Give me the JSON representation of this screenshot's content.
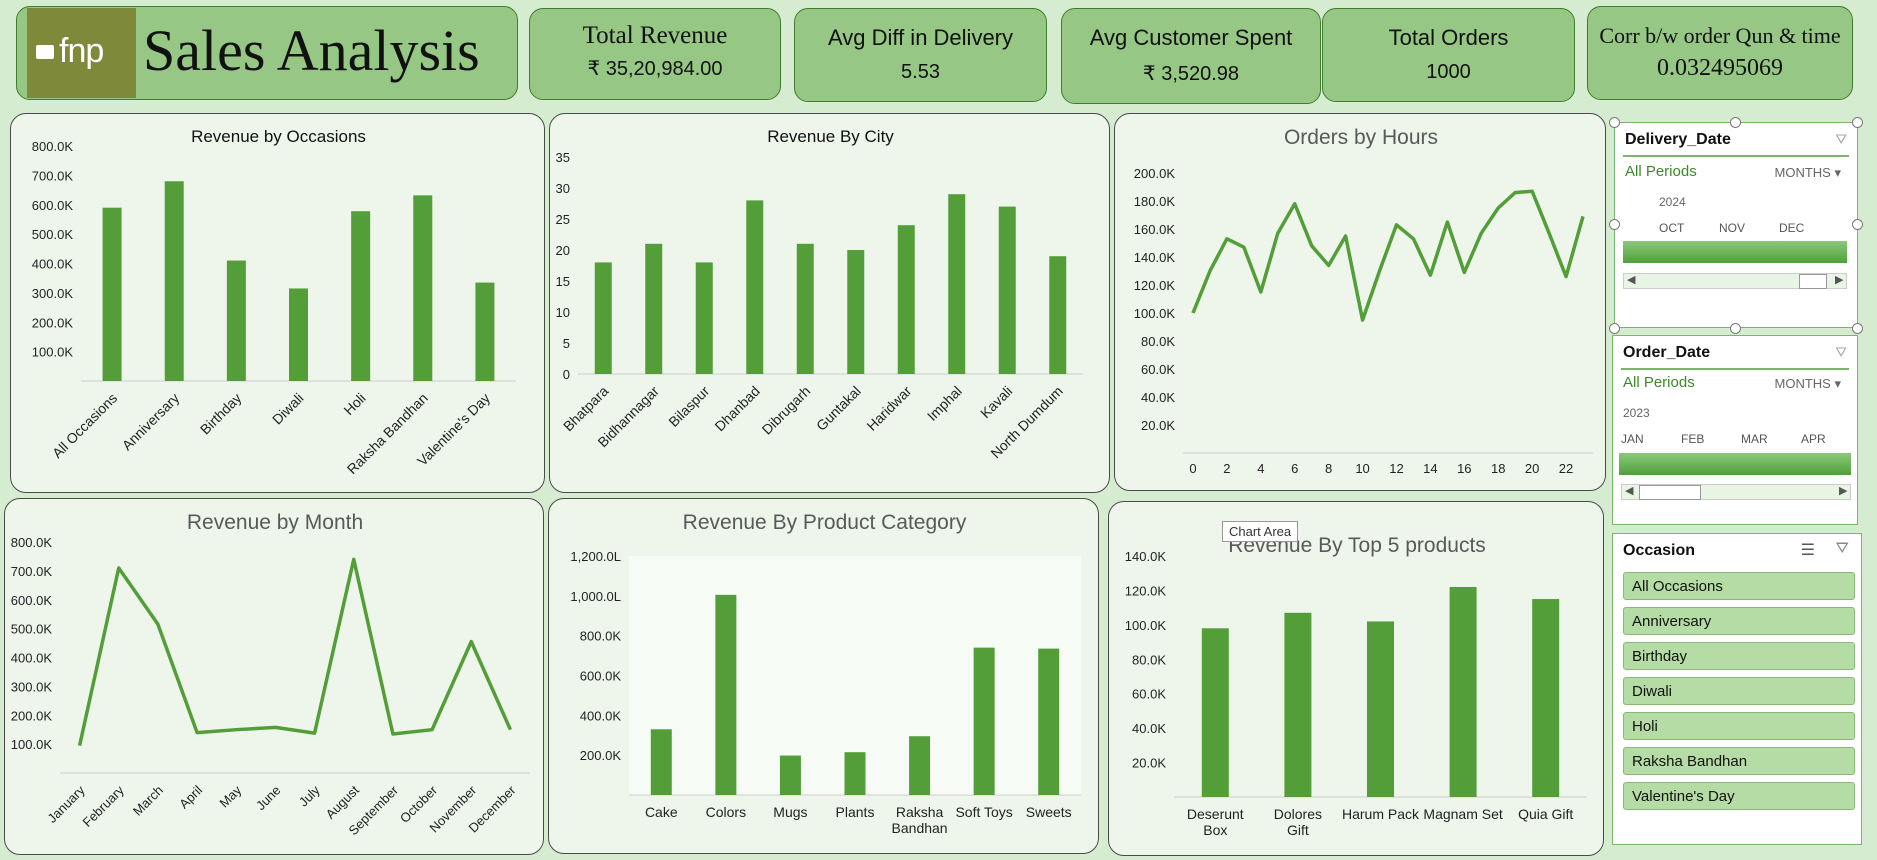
{
  "header": {
    "logo_text": "fnp",
    "title": "Sales Analysis"
  },
  "kpis": {
    "total_revenue": {
      "title": "Total Revenue",
      "value": "₹ 35,20,984.00"
    },
    "avg_diff": {
      "title": "Avg Diff in Delivery",
      "value": "5.53"
    },
    "avg_spent": {
      "title": "Avg Customer Spent",
      "value": "₹ 3,520.98"
    },
    "total_orders": {
      "title": "Total Orders",
      "value": "1000"
    },
    "corr": {
      "title": "Corr b/w order Qun &  time",
      "value": "0.032495069"
    }
  },
  "tooltip": "Chart Area",
  "slicers": {
    "delivery": {
      "title": "Delivery_Date",
      "period": "All Periods",
      "months": "MONTHS",
      "year": "2024",
      "month_labels": [
        "OCT",
        "NOV",
        "DEC"
      ]
    },
    "order": {
      "title": "Order_Date",
      "period": "All Periods",
      "months": "MONTHS",
      "year": "2023",
      "month_labels": [
        "JAN",
        "FEB",
        "MAR",
        "APR"
      ]
    },
    "occasion": {
      "title": "Occasion",
      "items": [
        "All Occasions",
        "Anniversary",
        "Birthday",
        "Diwali",
        "Holi",
        "Raksha Bandhan",
        "Valentine's Day"
      ]
    }
  },
  "colors": {
    "bar": "#549e39",
    "accent": "#3b8a2a",
    "card": "#96c785"
  },
  "chart_data": [
    {
      "id": "occasions",
      "type": "bar",
      "title": "Revenue by Occasions",
      "categories": [
        "All Occasions",
        "Anniversary",
        "Birthday",
        "Diwali",
        "Holi",
        "Raksha Bandhan",
        "Valentine's Day"
      ],
      "values": [
        590000,
        680000,
        410000,
        315000,
        578000,
        632000,
        335000
      ],
      "yticks": [
        "100.0K",
        "200.0K",
        "300.0K",
        "400.0K",
        "500.0K",
        "600.0K",
        "700.0K",
        "800.0K"
      ],
      "ylim": [
        0,
        800000
      ]
    },
    {
      "id": "city",
      "type": "bar",
      "title": "Revenue By City",
      "categories": [
        "Bhatpara",
        "Bidhannagar",
        "Bilaspur",
        "Dhanbad",
        "Dibrugarh",
        "Guntakal",
        "Haridwar",
        "Imphal",
        "Kavali",
        "North Dumdum"
      ],
      "values": [
        18,
        21,
        18,
        28,
        21,
        20,
        24,
        29,
        27,
        19
      ],
      "yticks": [
        "0",
        "5",
        "10",
        "15",
        "20",
        "25",
        "30",
        "35"
      ],
      "ylim": [
        0,
        35
      ]
    },
    {
      "id": "hours",
      "type": "line",
      "title": "Orders by Hours",
      "x": [
        0,
        1,
        2,
        3,
        4,
        5,
        6,
        7,
        8,
        9,
        10,
        11,
        12,
        13,
        14,
        15,
        16,
        17,
        18,
        19,
        20,
        21,
        22,
        23
      ],
      "values": [
        100000,
        130000,
        153000,
        147000,
        115000,
        157000,
        178000,
        148000,
        134000,
        155000,
        95000,
        130000,
        163000,
        153000,
        127000,
        165000,
        129000,
        157000,
        175000,
        186000,
        187000,
        157000,
        126000,
        169000
      ],
      "xticks": [
        "0",
        "2",
        "4",
        "6",
        "8",
        "10",
        "12",
        "14",
        "16",
        "18",
        "20",
        "22"
      ],
      "yticks": [
        "20.0K",
        "40.0K",
        "60.0K",
        "80.0K",
        "100.0K",
        "120.0K",
        "140.0K",
        "160.0K",
        "180.0K",
        "200.0K"
      ],
      "ylim": [
        0,
        200000
      ]
    },
    {
      "id": "month",
      "type": "line",
      "title": "Revenue by Month",
      "categories": [
        "January",
        "February",
        "March",
        "April",
        "May",
        "June",
        "July",
        "August",
        "September",
        "October",
        "November",
        "December"
      ],
      "values": [
        95000,
        710000,
        515000,
        140000,
        150000,
        158000,
        138000,
        740000,
        135000,
        150000,
        455000,
        150000
      ],
      "yticks": [
        "100.0K",
        "200.0K",
        "300.0K",
        "400.0K",
        "500.0K",
        "600.0K",
        "700.0K",
        "800.0K"
      ],
      "ylim": [
        0,
        800000
      ]
    },
    {
      "id": "category",
      "type": "bar",
      "title": "Revenue By Product Category",
      "categories": [
        "Cake",
        "Colors",
        "Mugs",
        "Plants",
        "Raksha Bandhan",
        "Soft Toys",
        "Sweets"
      ],
      "values": [
        330000,
        1005000,
        198000,
        215000,
        295000,
        740000,
        735000
      ],
      "yticks": [
        "200.0K",
        "400.0K",
        "600.0K",
        "800.0K",
        "1,000.0L",
        "1,200.0L"
      ],
      "ylim": [
        0,
        1200000
      ]
    },
    {
      "id": "top5",
      "type": "bar",
      "title": "Revenue By Top 5 products",
      "categories": [
        "Deserunt Box",
        "Dolores Gift",
        "Harum Pack",
        "Magnam Set",
        "Quia Gift"
      ],
      "values": [
        98000,
        107000,
        102000,
        122000,
        115000
      ],
      "yticks": [
        "20.0K",
        "40.0K",
        "60.0K",
        "80.0K",
        "100.0K",
        "120.0K",
        "140.0K"
      ],
      "ylim": [
        0,
        140000
      ]
    }
  ]
}
